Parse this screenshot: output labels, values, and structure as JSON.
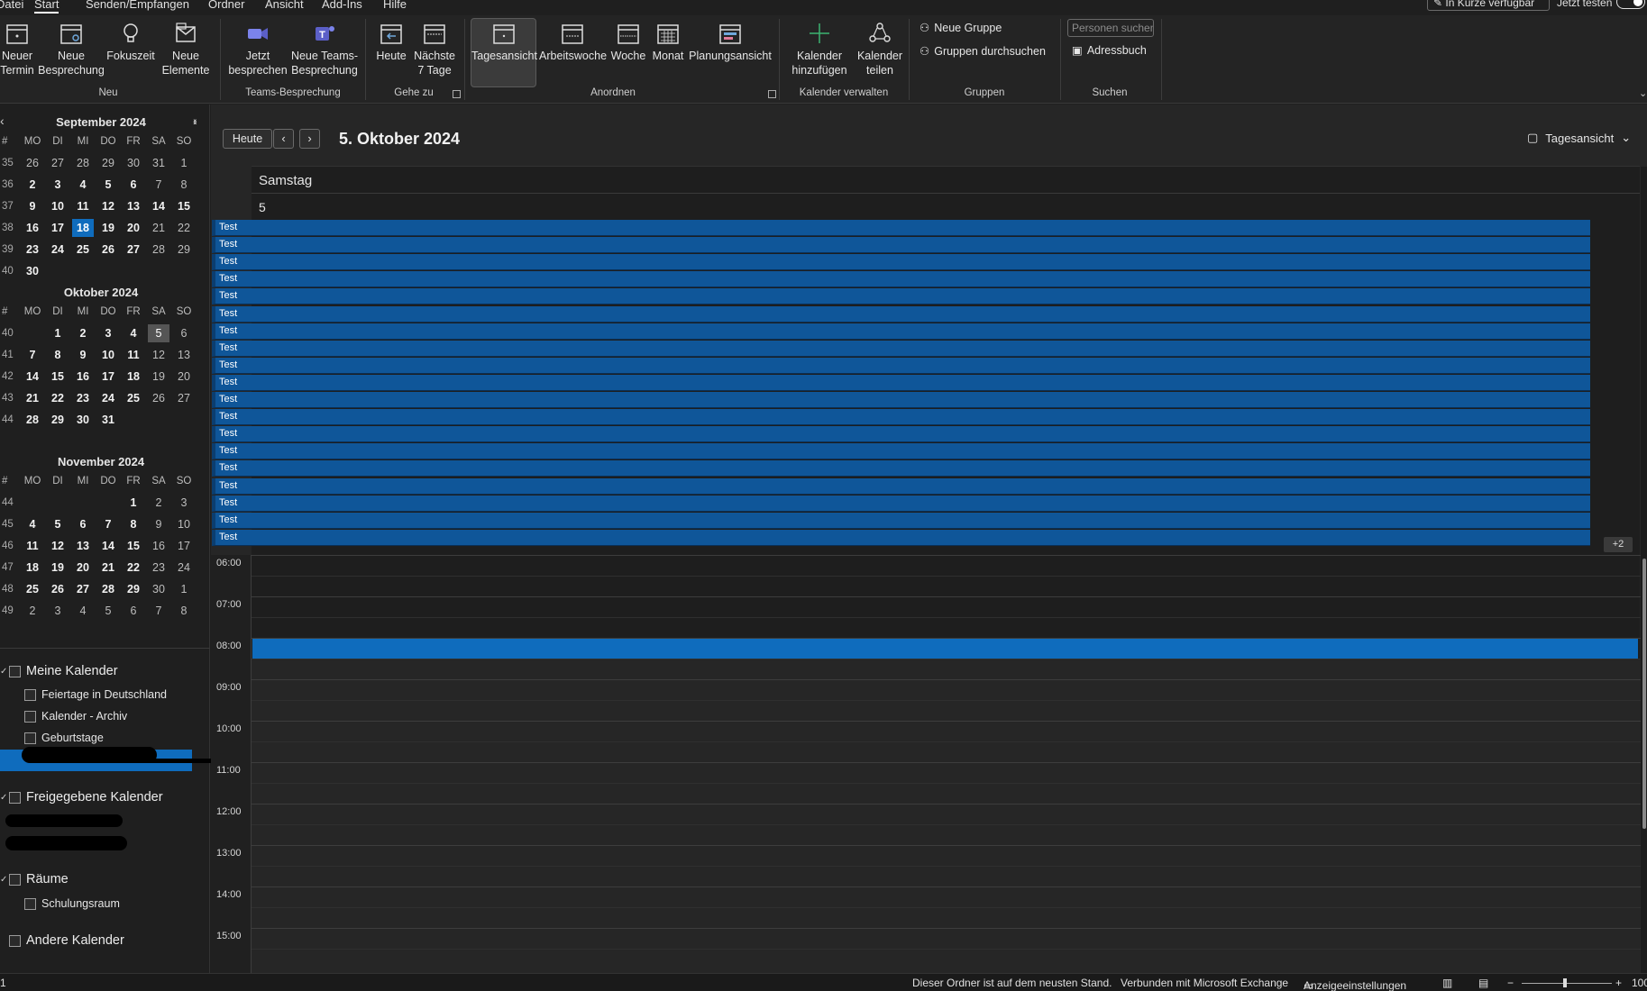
{
  "menubar": {
    "tabs": [
      "Datei",
      "Start",
      "Senden/Empfangen",
      "Ordner",
      "Ansicht",
      "Add-Ins",
      "Hilfe"
    ],
    "active_tab": "Start",
    "availability": "In Kürze verfügbar",
    "try_now": "Jetzt testen"
  },
  "ribbon": {
    "new_appointment": "Neuer\nTermin",
    "new_meeting": "Neue\nBesprechung",
    "focus_time": "Fokuszeit",
    "new_items": "Neue\nElemente",
    "group_new": "Neu",
    "meet_now": "Jetzt\nbesprechen",
    "new_teams_meeting": "Neue Teams-\nBesprechung",
    "group_teams": "Teams-Besprechung",
    "today": "Heute",
    "next_7_days": "Nächste\n7 Tage",
    "group_goto": "Gehe zu",
    "day_view": "Tagesansicht",
    "work_week": "Arbeitswoche",
    "week": "Woche",
    "month": "Monat",
    "schedule_view": "Planungsansicht",
    "group_arrange": "Anordnen",
    "add_calendar": "Kalender\nhinzufügen",
    "share_calendar": "Kalender\nteilen",
    "group_manage": "Kalender verwalten",
    "new_group": "Neue Gruppe",
    "browse_groups": "Gruppen durchsuchen",
    "group_groups": "Gruppen",
    "search_people": "Personen suchen",
    "address_book": "Adressbuch",
    "group_search": "Suchen"
  },
  "minicals": [
    {
      "title": "September 2024",
      "headers": [
        "#",
        "MO",
        "DI",
        "MI",
        "DO",
        "FR",
        "SA",
        "SO"
      ],
      "rows": [
        {
          "wk": "35",
          "days": [
            "26",
            "27",
            "28",
            "29",
            "30",
            "31",
            "1"
          ],
          "bold": [
            false,
            false,
            false,
            false,
            false,
            false,
            false
          ]
        },
        {
          "wk": "36",
          "days": [
            "2",
            "3",
            "4",
            "5",
            "6",
            "7",
            "8"
          ],
          "bold": [
            true,
            true,
            true,
            true,
            true,
            false,
            false
          ]
        },
        {
          "wk": "37",
          "days": [
            "9",
            "10",
            "11",
            "12",
            "13",
            "14",
            "15"
          ],
          "bold": [
            true,
            true,
            true,
            true,
            true,
            true,
            true
          ]
        },
        {
          "wk": "38",
          "days": [
            "16",
            "17",
            "18",
            "19",
            "20",
            "21",
            "22"
          ],
          "bold": [
            true,
            true,
            true,
            true,
            true,
            false,
            false
          ]
        },
        {
          "wk": "39",
          "days": [
            "23",
            "24",
            "25",
            "26",
            "27",
            "28",
            "29"
          ],
          "bold": [
            true,
            true,
            true,
            true,
            true,
            false,
            false
          ]
        },
        {
          "wk": "40",
          "days": [
            "30",
            "",
            "",
            "",
            "",
            "",
            ""
          ],
          "bold": [
            true,
            false,
            false,
            false,
            false,
            false,
            false
          ]
        }
      ],
      "today": {
        "row": 3,
        "col": 2
      }
    },
    {
      "title": "Oktober 2024",
      "headers": [
        "#",
        "MO",
        "DI",
        "MI",
        "DO",
        "FR",
        "SA",
        "SO"
      ],
      "rows": [
        {
          "wk": "40",
          "days": [
            "",
            "1",
            "2",
            "3",
            "4",
            "5",
            "6"
          ],
          "bold": [
            false,
            true,
            true,
            true,
            true,
            false,
            false
          ]
        },
        {
          "wk": "41",
          "days": [
            "7",
            "8",
            "9",
            "10",
            "11",
            "12",
            "13"
          ],
          "bold": [
            true,
            true,
            true,
            true,
            true,
            false,
            false
          ]
        },
        {
          "wk": "42",
          "days": [
            "14",
            "15",
            "16",
            "17",
            "18",
            "19",
            "20"
          ],
          "bold": [
            true,
            true,
            true,
            true,
            true,
            false,
            false
          ]
        },
        {
          "wk": "43",
          "days": [
            "21",
            "22",
            "23",
            "24",
            "25",
            "26",
            "27"
          ],
          "bold": [
            true,
            true,
            true,
            true,
            true,
            false,
            false
          ]
        },
        {
          "wk": "44",
          "days": [
            "28",
            "29",
            "30",
            "31",
            "",
            "",
            ""
          ],
          "bold": [
            true,
            true,
            true,
            true,
            false,
            false,
            false
          ]
        }
      ],
      "selected": {
        "row": 0,
        "col": 5
      }
    },
    {
      "title": "November 2024",
      "headers": [
        "#",
        "MO",
        "DI",
        "MI",
        "DO",
        "FR",
        "SA",
        "SO"
      ],
      "rows": [
        {
          "wk": "44",
          "days": [
            "",
            "",
            "",
            "",
            "1",
            "2",
            "3"
          ],
          "bold": [
            false,
            false,
            false,
            false,
            true,
            false,
            false
          ]
        },
        {
          "wk": "45",
          "days": [
            "4",
            "5",
            "6",
            "7",
            "8",
            "9",
            "10"
          ],
          "bold": [
            true,
            true,
            true,
            true,
            true,
            false,
            false
          ]
        },
        {
          "wk": "46",
          "days": [
            "11",
            "12",
            "13",
            "14",
            "15",
            "16",
            "17"
          ],
          "bold": [
            true,
            true,
            true,
            true,
            true,
            false,
            false
          ]
        },
        {
          "wk": "47",
          "days": [
            "18",
            "19",
            "20",
            "21",
            "22",
            "23",
            "24"
          ],
          "bold": [
            true,
            true,
            true,
            true,
            true,
            false,
            false
          ]
        },
        {
          "wk": "48",
          "days": [
            "25",
            "26",
            "27",
            "28",
            "29",
            "30",
            "1"
          ],
          "bold": [
            true,
            true,
            true,
            true,
            true,
            false,
            false
          ]
        },
        {
          "wk": "49",
          "days": [
            "2",
            "3",
            "4",
            "5",
            "6",
            "7",
            "8"
          ],
          "bold": [
            false,
            false,
            false,
            false,
            false,
            false,
            false
          ]
        }
      ]
    }
  ],
  "calendars": {
    "my_calendars": "Meine Kalender",
    "my_items": [
      "Feiertage in Deutschland",
      "Kalender - Archiv",
      "Geburtstage"
    ],
    "shared_calendars": "Freigegebene Kalender",
    "rooms": "Räume",
    "room_items": [
      "Schulungsraum"
    ],
    "other_calendars": "Andere Kalender"
  },
  "main": {
    "today_button": "Heute",
    "date_title": "5. Oktober 2024",
    "view_selector": "Tagesansicht",
    "day_name": "Samstag",
    "day_number": "5",
    "allday_events": [
      "Test",
      "Test",
      "Test",
      "Test",
      "Test",
      "Test",
      "Test",
      "Test",
      "Test",
      "Test",
      "Test",
      "Test",
      "Test",
      "Test",
      "Test",
      "Test",
      "Test",
      "Test",
      "Test"
    ],
    "more_events": "+2",
    "hours": [
      "06:00",
      "07:00",
      "08:00",
      "09:00",
      "10:00",
      "11:00",
      "12:00",
      "13:00",
      "14:00",
      "15:00"
    ]
  },
  "status": {
    "left": "1",
    "folder_status": "Dieser Ordner ist auf dem neusten Stand.",
    "connection": "Verbunden mit Microsoft Exchange",
    "display_settings": "Anzeigeeinstellungen",
    "zoom": "100"
  }
}
